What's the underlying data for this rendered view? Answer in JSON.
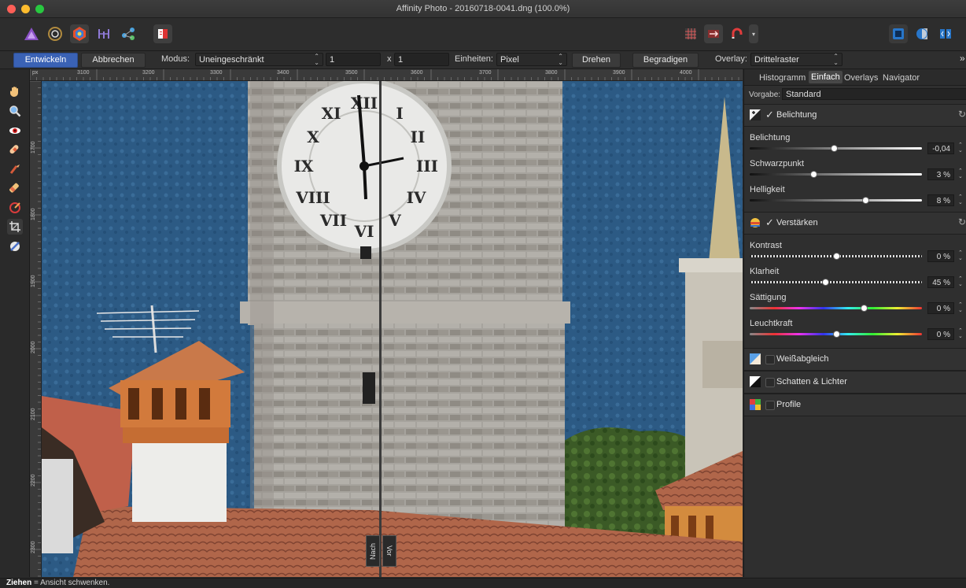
{
  "window": {
    "title": "Affinity Photo - 20160718-0041.dng (100.0%)"
  },
  "persona_toolbar": {
    "icons": [
      "photo-persona-icon",
      "liquify-persona-icon",
      "develop-persona-icon",
      "tone-mapping-persona-icon",
      "export-persona-icon"
    ],
    "right_icons": [
      "grid-icon",
      "split-view-icon",
      "magnet-icon",
      "dropdown-icon"
    ]
  },
  "context_toolbar": {
    "develop_label": "Entwickeln",
    "cancel_label": "Abbrechen",
    "mode_label": "Modus:",
    "mode_value": "Uneingeschränkt",
    "ratio_a": "1",
    "ratio_sep": "x",
    "ratio_b": "1",
    "units_label": "Einheiten:",
    "units_value": "Pixel",
    "rotate_label": "Drehen",
    "straighten_label": "Begradigen",
    "overlay_label": "Overlay:",
    "overlay_value": "Drittelraster",
    "close_glyph": "»"
  },
  "rulers": {
    "unit": "px",
    "horizontal": [
      "3100",
      "3200",
      "3300",
      "3400",
      "3500",
      "3600",
      "3700",
      "3800",
      "3900",
      "4000"
    ],
    "vertical": [
      "1700",
      "1800",
      "1900",
      "2000",
      "2100",
      "2200",
      "2300"
    ]
  },
  "canvas": {
    "split_left_label": "Nach",
    "split_right_label": "Vor"
  },
  "panel": {
    "tabs": [
      "Histogramm",
      "Einfach",
      "Overlays",
      "Navigator"
    ],
    "active_tab": "Einfach",
    "preset_label": "Vorgabe:",
    "preset_value": "Standard",
    "sections": {
      "exposure": {
        "title": "Belichtung",
        "check": "✓",
        "sliders": [
          {
            "label": "Belichtung",
            "value": "-0,04",
            "pos": 0.49
          },
          {
            "label": "Schwarzpunkt",
            "value": "3 %",
            "pos": 0.37
          },
          {
            "label": "Helligkeit",
            "value": "8 %",
            "pos": 0.67
          }
        ]
      },
      "enhance": {
        "title": "Verstärken",
        "check": "✓",
        "sliders": [
          {
            "label": "Kontrast",
            "value": "0 %",
            "pos": 0.5
          },
          {
            "label": "Klarheit",
            "value": "45 %",
            "pos": 0.44
          },
          {
            "label": "Sättigung",
            "value": "0 %",
            "pos": 0.66
          },
          {
            "label": "Leuchtkraft",
            "value": "0 %",
            "pos": 0.5
          }
        ]
      },
      "white_balance": {
        "title": "Weißabgleich"
      },
      "shadows": {
        "title": "Schatten & Lichter"
      },
      "profiles": {
        "title": "Profile"
      }
    }
  },
  "status_bar": {
    "bold": "Ziehen",
    "text": " = Ansicht schwenken."
  },
  "colors": {
    "accent": "#3a62b5",
    "sky": "#2d5a85",
    "stone": "#9d9a95"
  }
}
